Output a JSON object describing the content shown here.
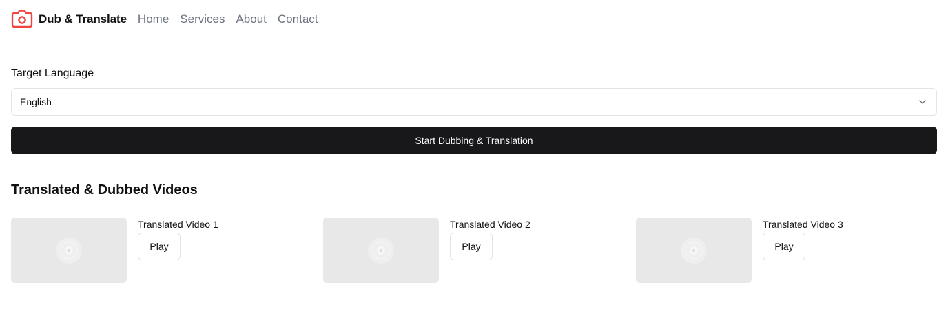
{
  "header": {
    "brand": "Dub & Translate",
    "logo_icon": "camera-icon",
    "nav": [
      "Home",
      "Services",
      "About",
      "Contact"
    ]
  },
  "form": {
    "language_label": "Target Language",
    "language_value": "English",
    "start_button": "Start Dubbing & Translation"
  },
  "videos": {
    "section_title": "Translated & Dubbed Videos",
    "items": [
      {
        "title": "Translated Video 1",
        "play_label": "Play"
      },
      {
        "title": "Translated Video 2",
        "play_label": "Play"
      },
      {
        "title": "Translated Video 3",
        "play_label": "Play"
      }
    ]
  },
  "colors": {
    "brand_accent": "#ef4444",
    "primary_button": "#18181b",
    "nav_text": "#6b7280",
    "thumbnail_bg": "#e8e8e8"
  }
}
